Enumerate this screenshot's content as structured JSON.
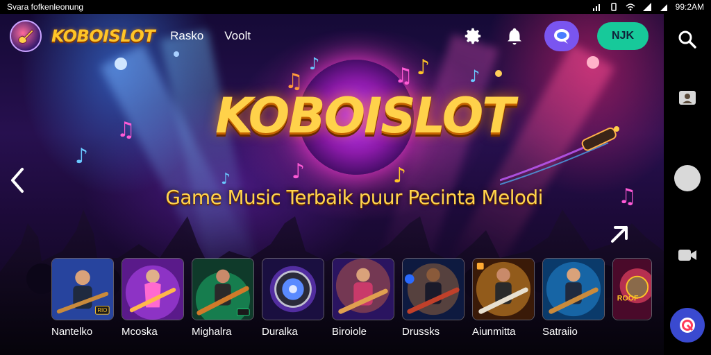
{
  "status_bar": {
    "left_text": "Svara fofkenleonung",
    "time": "99:2AM"
  },
  "header": {
    "brand": "KOBOISLOT",
    "nav": [
      "Rasko",
      "Voolt"
    ],
    "button_label": "NJK"
  },
  "hero": {
    "title": "KOBOISLOT",
    "tagline": "Game Music Terbaik puur Pecinta Melodi"
  },
  "games": [
    {
      "label": "Nantelko",
      "badge": "RIO",
      "accent": "#3b6cff"
    },
    {
      "label": "Mcoska",
      "badge": "",
      "accent": "#c04cff"
    },
    {
      "label": "Mighalra",
      "badge": "",
      "accent": "#1fd07a"
    },
    {
      "label": "Duralka",
      "badge": "",
      "accent": "#8a4cff"
    },
    {
      "label": "Biroiole",
      "badge": "",
      "accent": "#ff7a3c"
    },
    {
      "label": "Drussks",
      "badge": "",
      "accent": "#ff9a3c"
    },
    {
      "label": "Aiunmitta",
      "badge": "",
      "accent": "#ffaa33"
    },
    {
      "label": "Satraiio",
      "badge": "",
      "accent": "#2aa8ff"
    },
    {
      "label": "",
      "badge": "ROOF",
      "accent": "#ff4a6a"
    }
  ],
  "colors": {
    "brand_gold": "#ffc527",
    "accent_teal": "#17c99a",
    "accent_purple": "#7a55f0"
  },
  "icons": [
    "search-icon",
    "settings-icon",
    "bell-icon",
    "chat-icon",
    "chevron-left-icon",
    "chevron-right-icon"
  ]
}
